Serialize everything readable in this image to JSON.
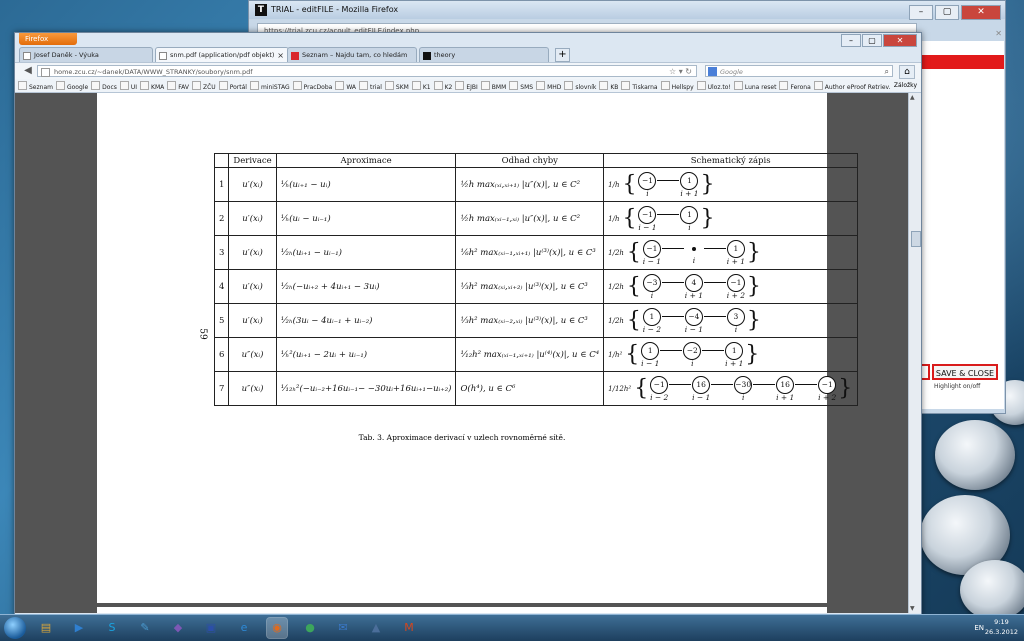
{
  "back_window": {
    "title": "TRIAL - editFILE - Mozilla Firefox",
    "url": "https://trial.zcu.cz/acoult_editFILE/index.php",
    "save_button": "SAVE & CLOSE",
    "highlight": "Highlight on/off"
  },
  "firefox": {
    "menu_label": "Firefox",
    "tabs": [
      {
        "label": "Josef Daněk - Výuka",
        "icon": "page-icon"
      },
      {
        "label": "snm.pdf (application/pdf objekt)",
        "icon": "pdf-icon",
        "active": true
      },
      {
        "label": "Seznam – Najdu tam, co hledám",
        "icon": "seznam-icon"
      },
      {
        "label": "theory",
        "icon": "t-icon"
      }
    ],
    "new_tab": "+",
    "url": "home.zcu.cz/~danek/DATA/WWW_STRANKY/soubory/snm.pdf",
    "search_placeholder": "Google",
    "bookmarks": [
      "Seznam",
      "Google",
      "Docs",
      "UI",
      "KMA",
      "FAV",
      "ZČU",
      "Portál",
      "miniSTAG",
      "PracDoba",
      "WA",
      "trial",
      "SKM",
      "K1",
      "K2",
      "EJBI",
      "BMM",
      "SMS",
      "MHD",
      "slovník",
      "KB",
      "Tiskarna",
      "Hellspy",
      "Uloz.to!",
      "Luna reset",
      "Ferona",
      "Author eProof Retriev..."
    ],
    "bookmarks_end": "Záložky"
  },
  "document": {
    "page_number": "59",
    "headers": [
      "Derivace",
      "Aproximace",
      "Odhad chyby",
      "Schematický zápis"
    ],
    "rows": [
      {
        "n": "1",
        "der": "u′(xᵢ)",
        "apr": "¹⁄ₕ(uᵢ₊₁ − uᵢ)",
        "err": "½h max₍ₓᵢ,ₓᵢ₊₁₎ |u″(x)|,  u ∈ C²",
        "coef": "1/h",
        "nodes": [
          {
            "v": "−1",
            "l": "i"
          },
          {
            "v": "1",
            "l": "i + 1"
          }
        ]
      },
      {
        "n": "2",
        "der": "u′(xᵢ)",
        "apr": "¹⁄ₕ(uᵢ − uᵢ₋₁)",
        "err": "½h max₍ₓᵢ₋₁,ₓᵢ₎ |u″(x)|,  u ∈ C²",
        "coef": "1/h",
        "nodes": [
          {
            "v": "−1",
            "l": "i − 1"
          },
          {
            "v": "1",
            "l": "i"
          }
        ]
      },
      {
        "n": "3",
        "der": "u′(xᵢ)",
        "apr": "¹⁄₂ₕ(uᵢ₊₁ − uᵢ₋₁)",
        "err": "⅙h² max₍ₓᵢ₋₁,ₓᵢ₊₁₎ |u⁽³⁾(x)|,  u ∈ C³",
        "coef": "1/2h",
        "nodes": [
          {
            "v": "−1",
            "l": "i − 1"
          },
          {
            "v": "•",
            "l": "i",
            "dot": true
          },
          {
            "v": "1",
            "l": "i + 1"
          }
        ]
      },
      {
        "n": "4",
        "der": "u′(xᵢ)",
        "apr": "¹⁄₂ₕ(−uᵢ₊₂ + 4uᵢ₊₁ − 3uᵢ)",
        "err": "⅓h² max₍ₓᵢ,ₓᵢ₊₂₎ |u⁽³⁾(x)|,  u ∈ C³",
        "coef": "1/2h",
        "nodes": [
          {
            "v": "−3",
            "l": "i"
          },
          {
            "v": "4",
            "l": "i + 1"
          },
          {
            "v": "−1",
            "l": "i + 2"
          }
        ]
      },
      {
        "n": "5",
        "der": "u′(xᵢ)",
        "apr": "¹⁄₂ₕ(3uᵢ − 4uᵢ₋₁ + uᵢ₋₂)",
        "err": "⅓h² max₍ₓᵢ₋₂,ₓᵢ₎ |u⁽³⁾(x)|,  u ∈ C³",
        "coef": "1/2h",
        "nodes": [
          {
            "v": "1",
            "l": "i − 2"
          },
          {
            "v": "−4",
            "l": "i − 1"
          },
          {
            "v": "3",
            "l": "i"
          }
        ]
      },
      {
        "n": "6",
        "der": "u″(xᵢ)",
        "apr": "¹⁄ₕ²(uᵢ₊₁ − 2uᵢ + uᵢ₋₁)",
        "err": "¹⁄₁₂h² max₍ₓᵢ₋₁,ₓᵢ₊₁₎ |u⁽⁴⁾(x)|,  u ∈ C⁴",
        "coef": "1/h²",
        "nodes": [
          {
            "v": "1",
            "l": "i − 1"
          },
          {
            "v": "−2",
            "l": "i"
          },
          {
            "v": "1",
            "l": "i + 1"
          }
        ]
      },
      {
        "n": "7",
        "der": "u″(xᵢ)",
        "apr": "¹⁄₁₂ₕ²(−uᵢ₋₂+16uᵢ₋₁− −30uᵢ+16uᵢ₊₁−uᵢ₊₂)",
        "err": "O(h⁴),  u ∈ C⁶",
        "coef": "1/12h²",
        "nodes": [
          {
            "v": "−1",
            "l": "i − 2"
          },
          {
            "v": "16",
            "l": "i − 1"
          },
          {
            "v": "−30",
            "l": "i"
          },
          {
            "v": "16",
            "l": "i + 1"
          },
          {
            "v": "−1",
            "l": "i + 2"
          }
        ]
      }
    ],
    "caption": "Tab. 3.  Aproximace derivací v uzlech rovnoměrné sítě."
  },
  "taskbar": {
    "apps": [
      "explorer-icon",
      "media-icon",
      "skype-icon",
      "notepad-icon",
      "app-icon",
      "save-icon",
      "ie-icon",
      "firefox-icon",
      "chrome-icon",
      "thunderbird-icon",
      "hat-icon",
      "matlab-icon"
    ],
    "lang": "EN",
    "time": "9:19",
    "date": "26.3.2012"
  }
}
